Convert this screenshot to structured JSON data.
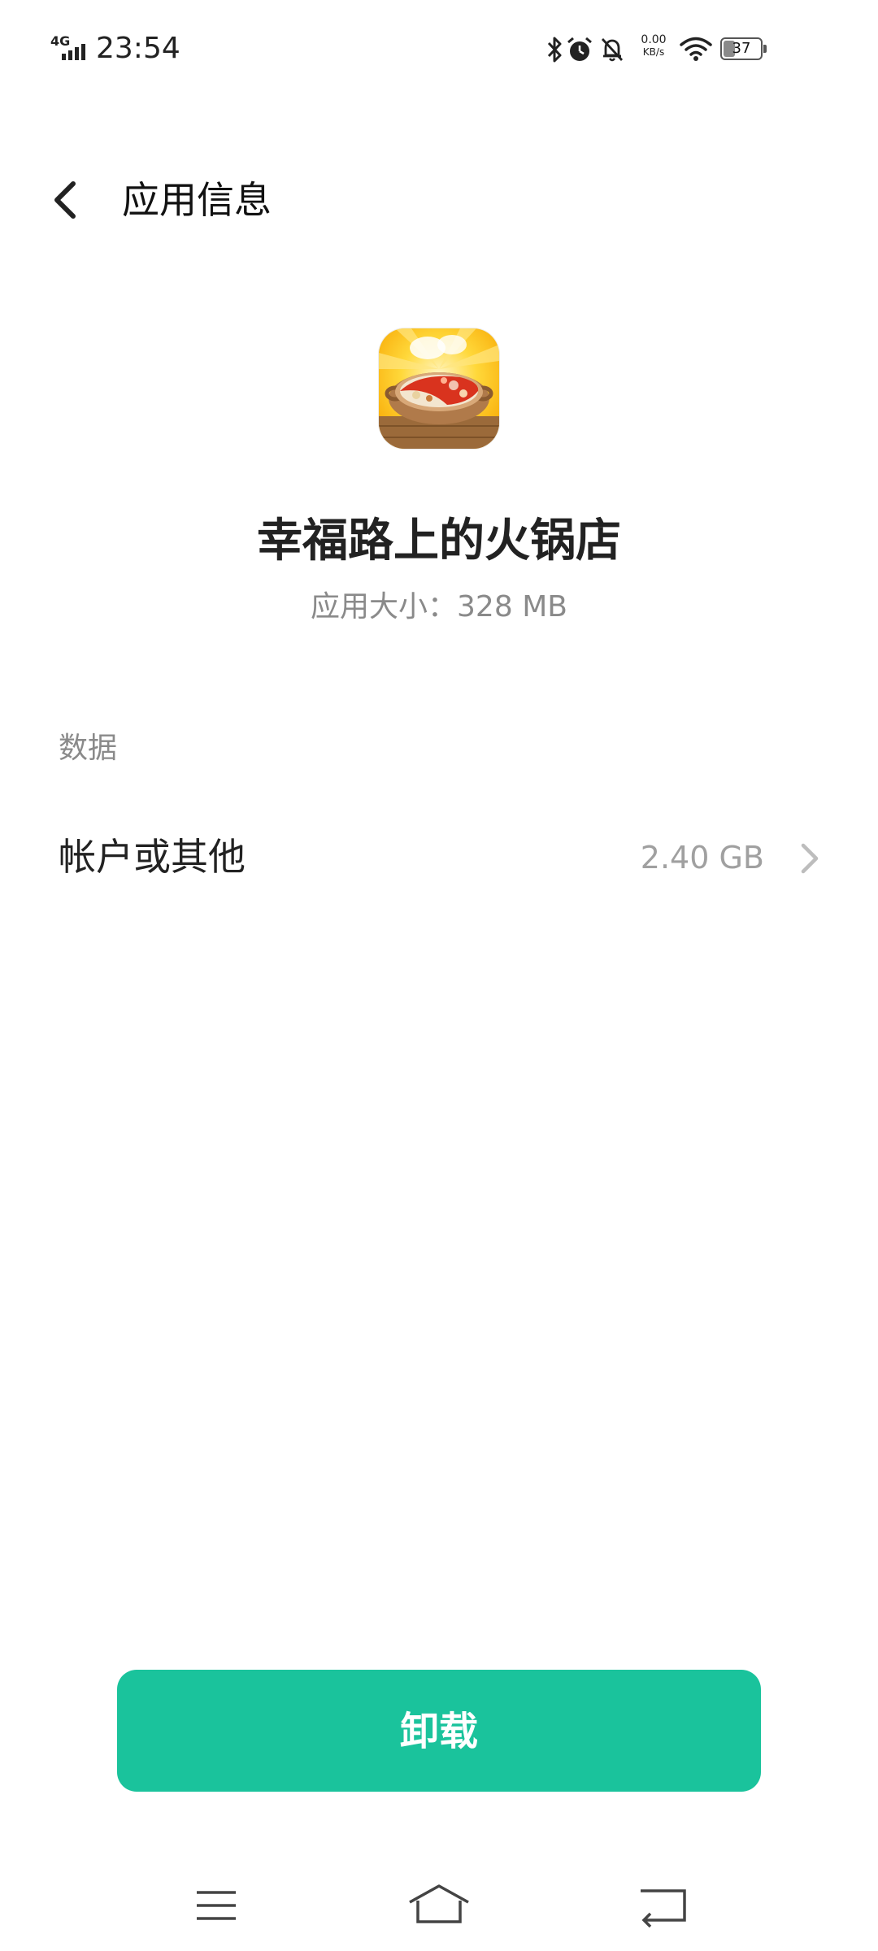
{
  "status_bar": {
    "network_type": "4G",
    "time": "23:54",
    "net_speed_value": "0.00",
    "net_speed_unit": "KB/s",
    "battery_level": "37",
    "battery_fraction": 0.37
  },
  "header": {
    "title": "应用信息"
  },
  "app": {
    "name": "幸福路上的火锅店",
    "size_text": "应用大小：328  MB"
  },
  "data_section": {
    "label": "数据",
    "rows": [
      {
        "label": "帐户或其他",
        "value": "2.40  GB"
      }
    ]
  },
  "actions": {
    "uninstall_label": "卸载"
  },
  "colors": {
    "accent": "#1ac39c",
    "secondary_text": "#8a8a8a"
  },
  "icons": {
    "back": "chevron-left-icon",
    "row_arrow": "chevron-right-icon",
    "nav_menu": "menu-icon",
    "nav_home": "home-icon",
    "nav_back": "back-arrow-icon"
  }
}
